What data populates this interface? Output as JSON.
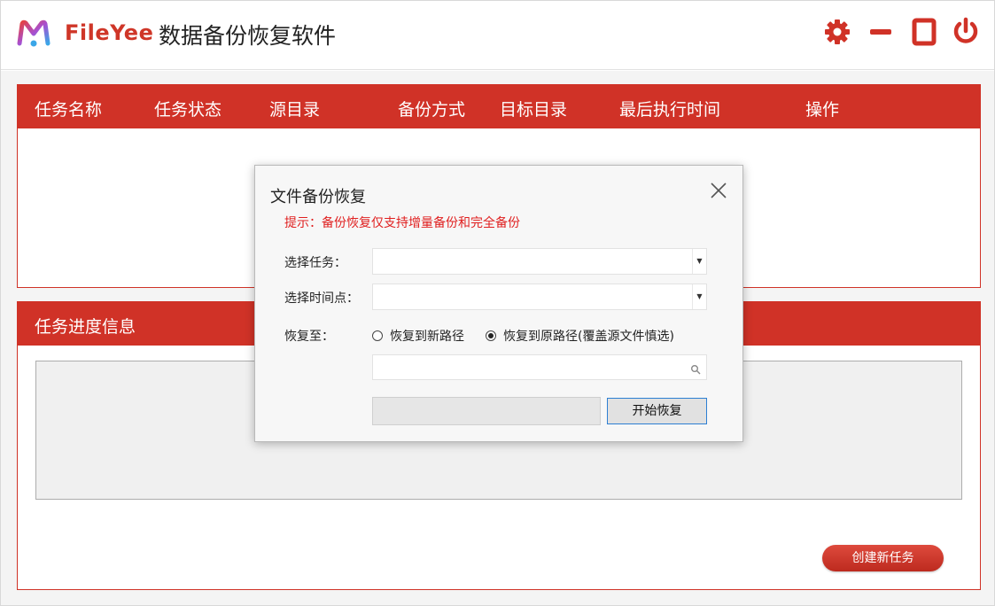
{
  "app": {
    "logo_text": "FileYee",
    "title": "数据备份恢复软件"
  },
  "titlebar_icons": [
    "gear-icon",
    "minimize-icon",
    "maximize-icon",
    "power-icon"
  ],
  "table": {
    "headers": [
      "任务名称",
      "任务状态",
      "源目录",
      "备份方式",
      "目标目录",
      "最后执行时间",
      "操作"
    ]
  },
  "progress_panel": {
    "title": "任务进度信息"
  },
  "create_task_button": "创建新任务",
  "dialog": {
    "title": "文件备份恢复",
    "hint": "提示：备份恢复仅支持增量备份和完全备份",
    "select_task_label": "选择任务：",
    "select_time_label": "选择时间点：",
    "restore_to_label": "恢复至：",
    "radio_new_path": "恢复到新路径",
    "radio_original_path": "恢复到原路径(覆盖源文件慎选)",
    "radio_selected": "original",
    "select_task_value": "",
    "select_time_value": "",
    "path_value": "",
    "start_button": "开始恢复"
  },
  "colors": {
    "brand_red": "#d03227",
    "hint_red": "#e02020"
  }
}
